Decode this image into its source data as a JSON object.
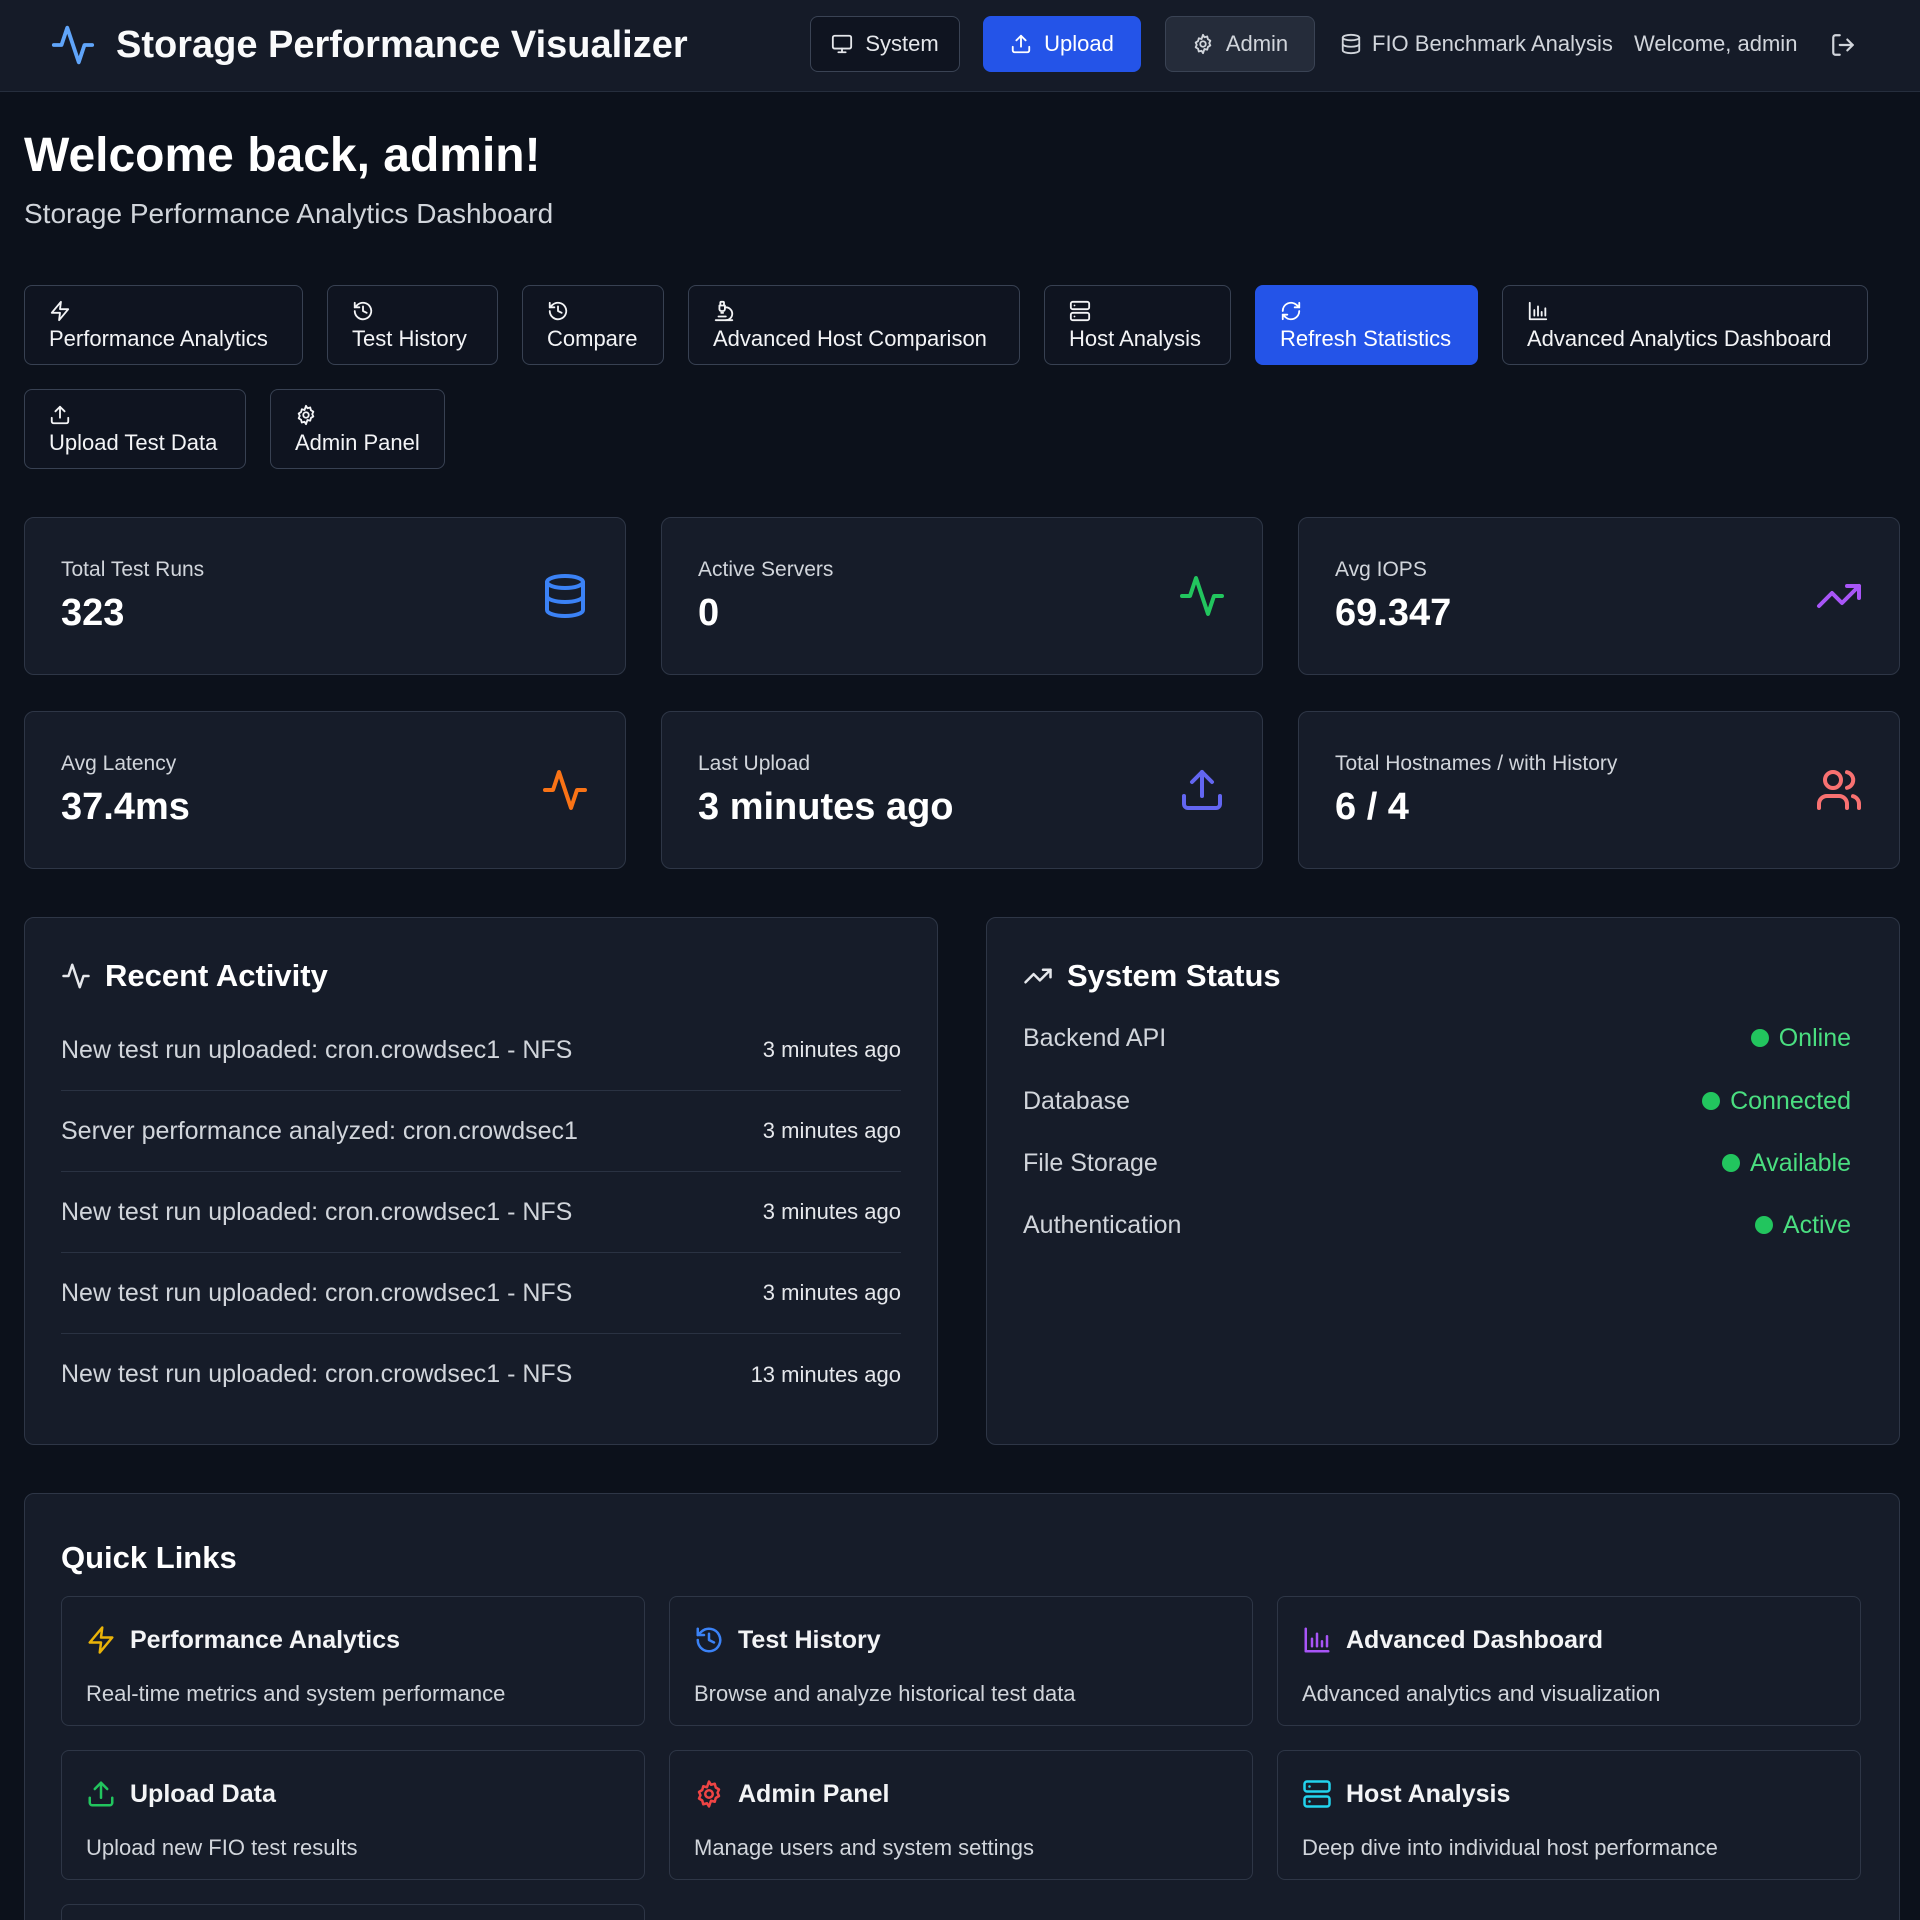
{
  "header": {
    "app_title": "Storage Performance Visualizer",
    "brand_icon": "activity-icon",
    "buttons": [
      {
        "label": "System",
        "icon": "monitor-icon"
      },
      {
        "label": "Upload",
        "icon": "upload-icon"
      },
      {
        "label": "Admin",
        "icon": "gear-icon"
      }
    ],
    "context_label": "FIO Benchmark Analysis",
    "welcome_user": "Welcome, admin",
    "accent_color": "#2454e8"
  },
  "welcome": {
    "title": "Welcome back, admin!",
    "subtitle": "Storage Performance Analytics Dashboard"
  },
  "nav": [
    {
      "label": "Performance Analytics",
      "icon": "zap-icon"
    },
    {
      "label": "Test History",
      "icon": "history-icon"
    },
    {
      "label": "Compare",
      "icon": "history-icon"
    },
    {
      "label": "Advanced Host Comparison",
      "icon": "microscope-icon"
    },
    {
      "label": "Host Analysis",
      "icon": "server-icon"
    },
    {
      "label": "Refresh Statistics",
      "icon": "refresh-icon",
      "active": true
    },
    {
      "label": "Advanced Analytics Dashboard",
      "icon": "bar-chart-icon"
    },
    {
      "label": "Upload Test Data",
      "icon": "upload-icon"
    },
    {
      "label": "Admin Panel",
      "icon": "gear-icon"
    }
  ],
  "stats": [
    {
      "label": "Total Test Runs",
      "value": "323",
      "icon": "database-icon",
      "color": "#3b82f6"
    },
    {
      "label": "Active Servers",
      "value": "0",
      "icon": "activity-icon",
      "color": "#22c55e"
    },
    {
      "label": "Avg IOPS",
      "value": "69.347",
      "icon": "trending-up-icon",
      "color": "#a855f7"
    },
    {
      "label": "Avg Latency",
      "value": "37.4ms",
      "icon": "activity-icon",
      "color": "#f97316"
    },
    {
      "label": "Last Upload",
      "value": "3 minutes ago",
      "icon": "upload-icon",
      "color": "#6366f1"
    },
    {
      "label": "Total Hostnames / with History",
      "value": "6 / 4",
      "icon": "users-icon",
      "color": "#f87171"
    }
  ],
  "recent_activity": {
    "title": "Recent Activity",
    "items": [
      {
        "text": "New test run uploaded: cron.crowdsec1 - NFS",
        "time": "3 minutes ago"
      },
      {
        "text": "Server performance analyzed: cron.crowdsec1",
        "time": "3 minutes ago"
      },
      {
        "text": "New test run uploaded: cron.crowdsec1 - NFS",
        "time": "3 minutes ago"
      },
      {
        "text": "New test run uploaded: cron.crowdsec1 - NFS",
        "time": "3 minutes ago"
      },
      {
        "text": "New test run uploaded: cron.crowdsec1 - NFS",
        "time": "13 minutes ago"
      }
    ]
  },
  "system_status": {
    "title": "System Status",
    "items": [
      {
        "name": "Backend API",
        "status": "Online"
      },
      {
        "name": "Database",
        "status": "Connected"
      },
      {
        "name": "File Storage",
        "status": "Available"
      },
      {
        "name": "Authentication",
        "status": "Active"
      }
    ],
    "status_color": "#22c55e"
  },
  "quick_links": {
    "title": "Quick Links",
    "items": [
      {
        "title": "Performance Analytics",
        "desc": "Real-time metrics and system performance",
        "icon": "zap-icon",
        "color": "#eab308"
      },
      {
        "title": "Test History",
        "desc": "Browse and analyze historical test data",
        "icon": "history-icon",
        "color": "#3b82f6"
      },
      {
        "title": "Advanced Dashboard",
        "desc": "Advanced analytics and visualization",
        "icon": "bar-chart-icon",
        "color": "#a855f7"
      },
      {
        "title": "Upload Data",
        "desc": "Upload new FIO test results",
        "icon": "upload-icon",
        "color": "#22c55e"
      },
      {
        "title": "Admin Panel",
        "desc": "Manage users and system settings",
        "icon": "gear-icon",
        "color": "#ef4444"
      },
      {
        "title": "Host Analysis",
        "desc": "Deep dive into individual host performance",
        "icon": "server-icon",
        "color": "#22d3ee"
      }
    ]
  }
}
